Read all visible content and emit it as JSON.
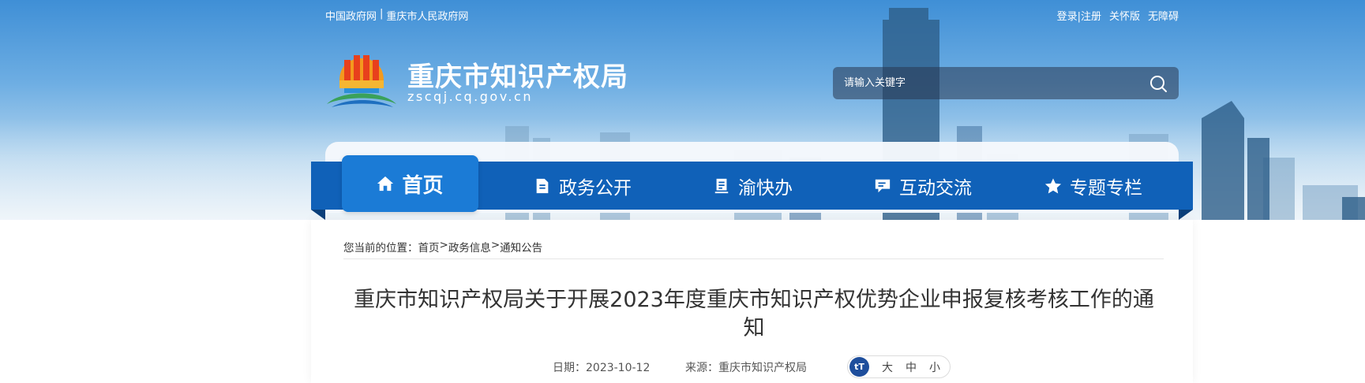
{
  "topbar": {
    "left_links": [
      "中国政府网",
      "|",
      "重庆市人民政府网"
    ],
    "right_links": [
      "登录|注册",
      "关怀版",
      "无障碍"
    ]
  },
  "header": {
    "title": "重庆市知识产权局",
    "domain": "zscqj.cq.gov.cn"
  },
  "search": {
    "placeholder": "请输入关键字",
    "icon": "search-icon"
  },
  "nav": {
    "items": [
      {
        "label": "首页",
        "icon": "home-icon",
        "active": true
      },
      {
        "label": "政务公开",
        "icon": "document-icon"
      },
      {
        "label": "渝快办",
        "icon": "book-icon"
      },
      {
        "label": "互动交流",
        "icon": "chat-icon"
      },
      {
        "label": "专题专栏",
        "icon": "star-icon"
      }
    ]
  },
  "breadcrumb": {
    "prefix": "您当前的位置：",
    "items": [
      "首页",
      "政务信息",
      "通知公告"
    ],
    "separator": ">"
  },
  "article": {
    "title": "重庆市知识产权局关于开展2023年度重庆市知识产权优势企业申报复核考核工作的通知",
    "date": "日期：2023-10-12",
    "source": "来源：重庆市知识产权局"
  },
  "font_size": {
    "icon_text": "tT",
    "options": [
      "大",
      "中",
      "小"
    ]
  },
  "colors": {
    "nav_bar": "#1061b8",
    "nav_active": "#1b7bd6",
    "text": "#333333"
  }
}
